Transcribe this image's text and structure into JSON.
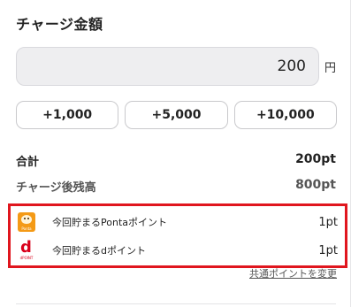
{
  "heading": "チャージ金額",
  "amount": {
    "value": "200",
    "unit": "円"
  },
  "quick_buttons": [
    "+1,000",
    "+5,000",
    "+10,000"
  ],
  "summary": {
    "total_label": "合計",
    "total_value": "200pt",
    "after_label": "チャージ後残高",
    "after_value": "800pt"
  },
  "points": [
    {
      "icon": "ponta-icon",
      "icon_text": "Ponta",
      "label": "今回貯まるPontaポイント",
      "value": "1pt"
    },
    {
      "icon": "d-point-icon",
      "icon_text": "dPOINT",
      "label": "今回貯まるdポイント",
      "value": "1pt"
    }
  ],
  "change_link": "共通ポイントを変更",
  "colors": {
    "highlight_border": "#e0161e",
    "ponta_orange": "#f49a16",
    "dpoint_red": "#d9001b"
  }
}
